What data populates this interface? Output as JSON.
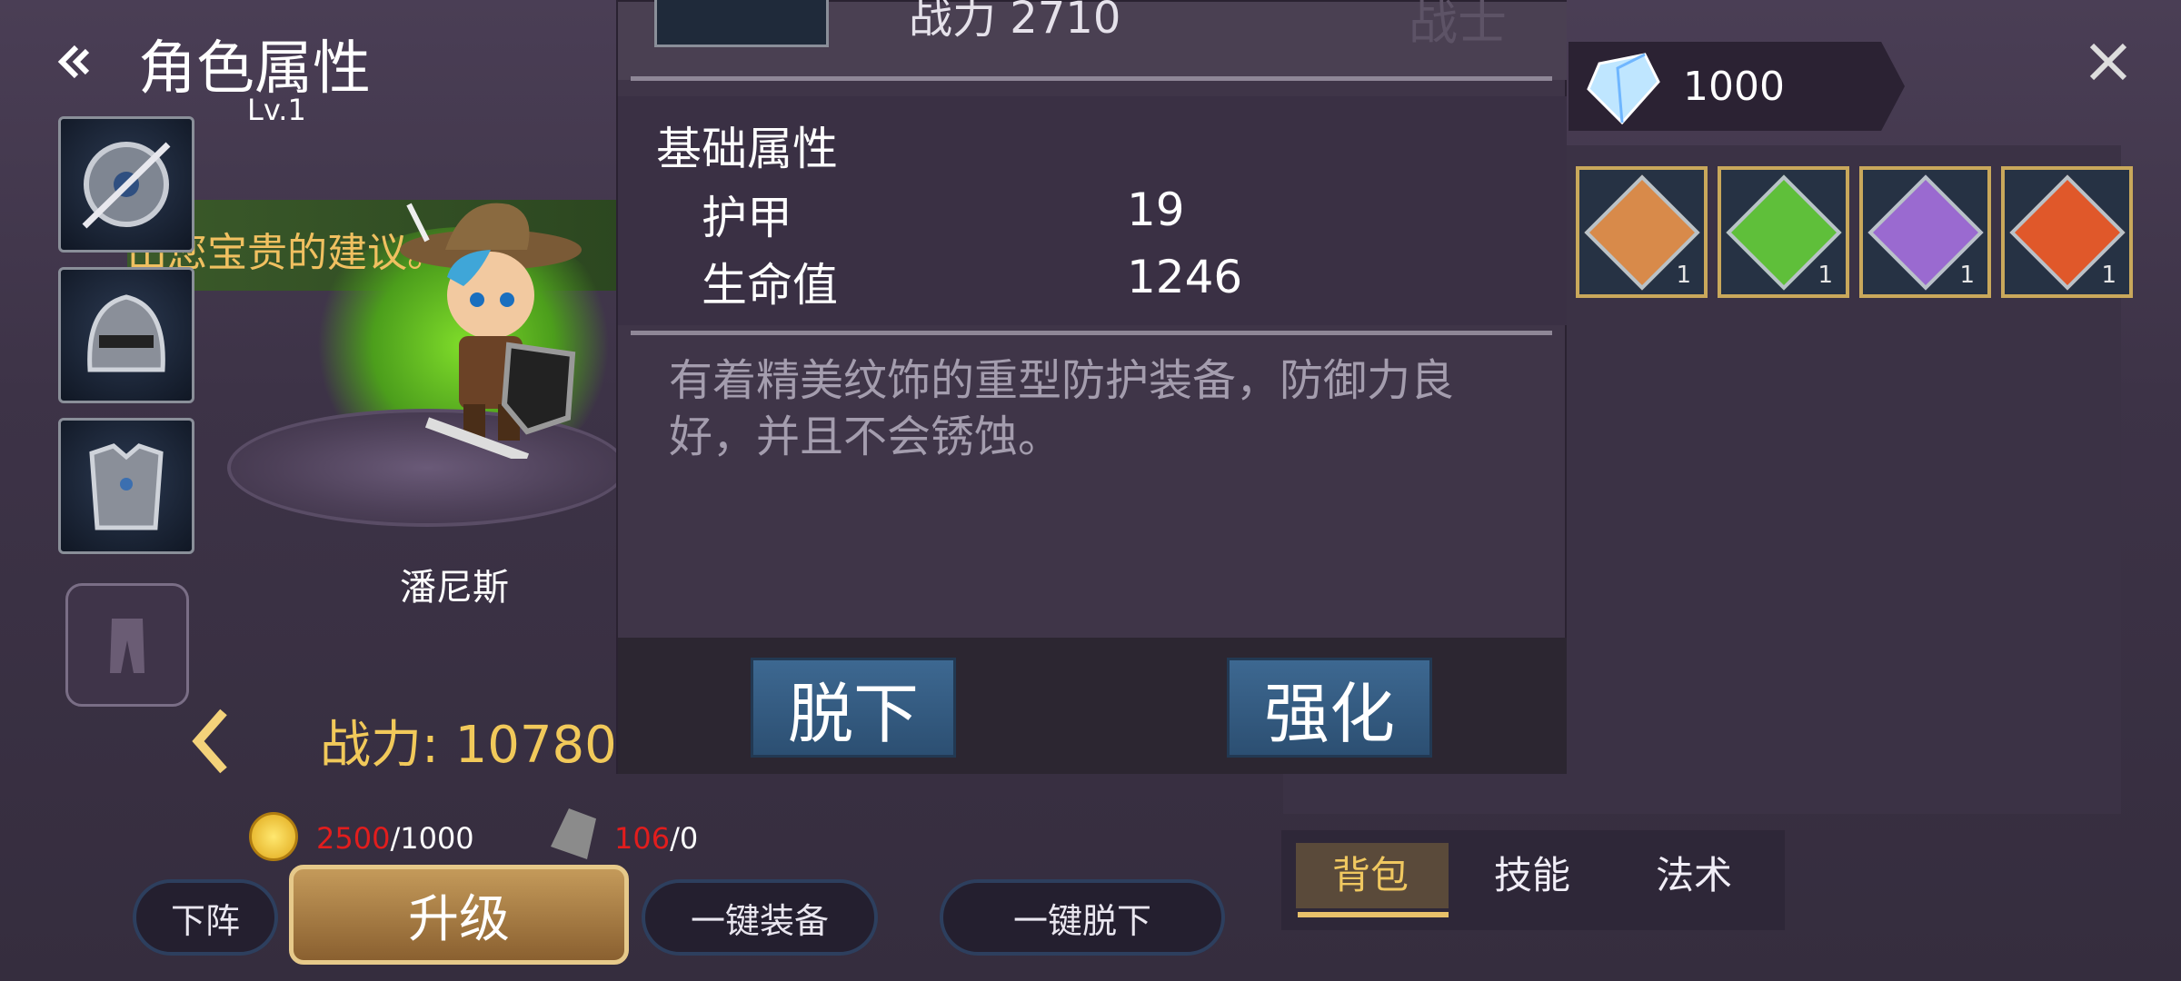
{
  "header": {
    "title": "角色属性",
    "level": "Lv.1"
  },
  "ticker": "出您宝贵的建议。",
  "hero": {
    "name": "潘尼斯",
    "power_label": "战力: 10780"
  },
  "costs": {
    "gold_have": "2500",
    "gold_need": "/1000",
    "stone_have": "106",
    "stone_need": "/0"
  },
  "buttons": {
    "lineup": "下阵",
    "upgrade": "升级",
    "equip_all": "一键装备",
    "unequip_all": "一键脱下"
  },
  "currency": {
    "gems": "1000"
  },
  "skills": [
    {
      "name": "skull-shield-skill",
      "qty": "1",
      "color": "#d88a4a"
    },
    {
      "name": "green-aura-skill",
      "qty": "1",
      "color": "#5fbf3a"
    },
    {
      "name": "purple-spirit-skill",
      "qty": "1",
      "color": "#9a6ad0"
    },
    {
      "name": "fire-warrior-skill",
      "qty": "1",
      "color": "#e0582a"
    }
  ],
  "tabs": {
    "bag": "背包",
    "skill": "技能",
    "spell": "法术"
  },
  "popup": {
    "power_text": "战力 2710",
    "class_text": "战士",
    "section_title": "基础属性",
    "stats": [
      {
        "label": "护甲",
        "value": "19"
      },
      {
        "label": "生命值",
        "value": "1246"
      }
    ],
    "description": "有着精美纹饰的重型防护装备，防御力良好，并且不会锈蚀。",
    "take_off": "脱下",
    "enhance": "强化"
  }
}
